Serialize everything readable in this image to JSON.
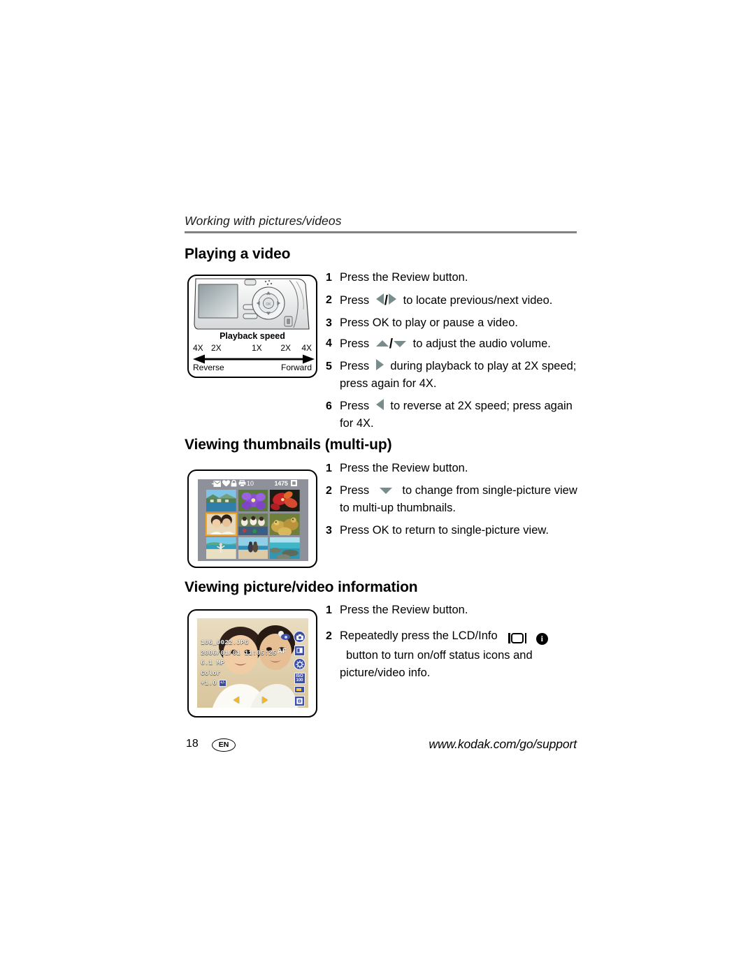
{
  "page": {
    "running_head": "Working with pictures/videos",
    "page_number": "18",
    "language_badge": "EN",
    "footer_url": "www.kodak.com/go/support"
  },
  "sections": [
    {
      "id": "playing-a-video",
      "title": "Playing a video",
      "steps": [
        {
          "num": "1",
          "before": "Press the Review button.",
          "icon": "",
          "after": ""
        },
        {
          "num": "2",
          "before": "Press",
          "icon": "left-right-arrows",
          "after": "to locate previous/next video."
        },
        {
          "num": "3",
          "before": "Press OK to play or pause a video.",
          "icon": "",
          "after": ""
        },
        {
          "num": "4",
          "before": "Press",
          "icon": "up-down-arrows",
          "after": "to adjust the audio volume."
        },
        {
          "num": "5",
          "before": "Press",
          "icon": "right-arrow",
          "after": "during playback to play at 2X speed; press again for 4X."
        },
        {
          "num": "6",
          "before": "Press",
          "icon": "left-arrow",
          "after": "to reverse at 2X speed; press again for 4X."
        }
      ]
    },
    {
      "id": "viewing-thumbnails",
      "title": "Viewing thumbnails (multi-up)",
      "steps": [
        {
          "num": "1",
          "before": "Press the Review button.",
          "icon": "",
          "after": ""
        },
        {
          "num": "2",
          "before": "Press",
          "icon": "down-arrow",
          "after": "to change from single-picture view to multi-up thumbnails."
        },
        {
          "num": "3",
          "before": "Press OK to return to single-picture view.",
          "icon": "",
          "after": ""
        }
      ]
    },
    {
      "id": "viewing-picture-video-information",
      "title": "Viewing picture/video information",
      "steps": [
        {
          "num": "1",
          "before": "Press the Review button.",
          "icon": "",
          "after": ""
        },
        {
          "num": "2",
          "before": "Repeatedly press the LCD/Info",
          "icon": "lcd-info-button",
          "after": "button to turn on/off status icons and picture/video info."
        }
      ]
    }
  ],
  "illustration_playback": {
    "caption": "Playback speed",
    "scale": {
      "reverse_4x": "4X",
      "reverse_2x": "2X",
      "center_1x": "1X",
      "forward_2x": "2X",
      "forward_4x": "4X"
    },
    "reverse_label": "Reverse",
    "forward_label": "Forward"
  },
  "illustration_thumbnails": {
    "status_icons": [
      "email-share-icon",
      "favorite-heart-icon",
      "protect-lock-icon",
      "print-order-icon"
    ],
    "print_count": "10",
    "pictures_remaining": "1475",
    "memory_icon": "internal-memory-icon",
    "thumbnail_count": 9,
    "selected_index": 3,
    "selection_color": "#f5a623",
    "lcd_background": "#8e9199"
  },
  "illustration_info": {
    "filename": "106_0022.JPG",
    "datetime": "2006/01/01  11:05:25",
    "resolution": "6.1 MP",
    "color_mode": "Color",
    "exposure_compensation": "+1.0",
    "focus_mode": "AF",
    "iso_label": "ISO",
    "iso_value": "100",
    "side_icons": [
      "still-camera-mode-icon",
      "lcd-display-icon",
      "white-balance-icon",
      "iso-100-icon",
      "battery-icon",
      "exposure-metering-icon"
    ],
    "red_eye_icon": "red-eye-icon",
    "nav_left_icon": "prev-picture-arrow",
    "nav_right_icon": "next-picture-arrow"
  },
  "colors": {
    "rule": "#808285",
    "arrow_glyph": "#7a8b8b",
    "lcd_icon_blue": "#3b4fa8",
    "selection_orange": "#f5a623"
  }
}
